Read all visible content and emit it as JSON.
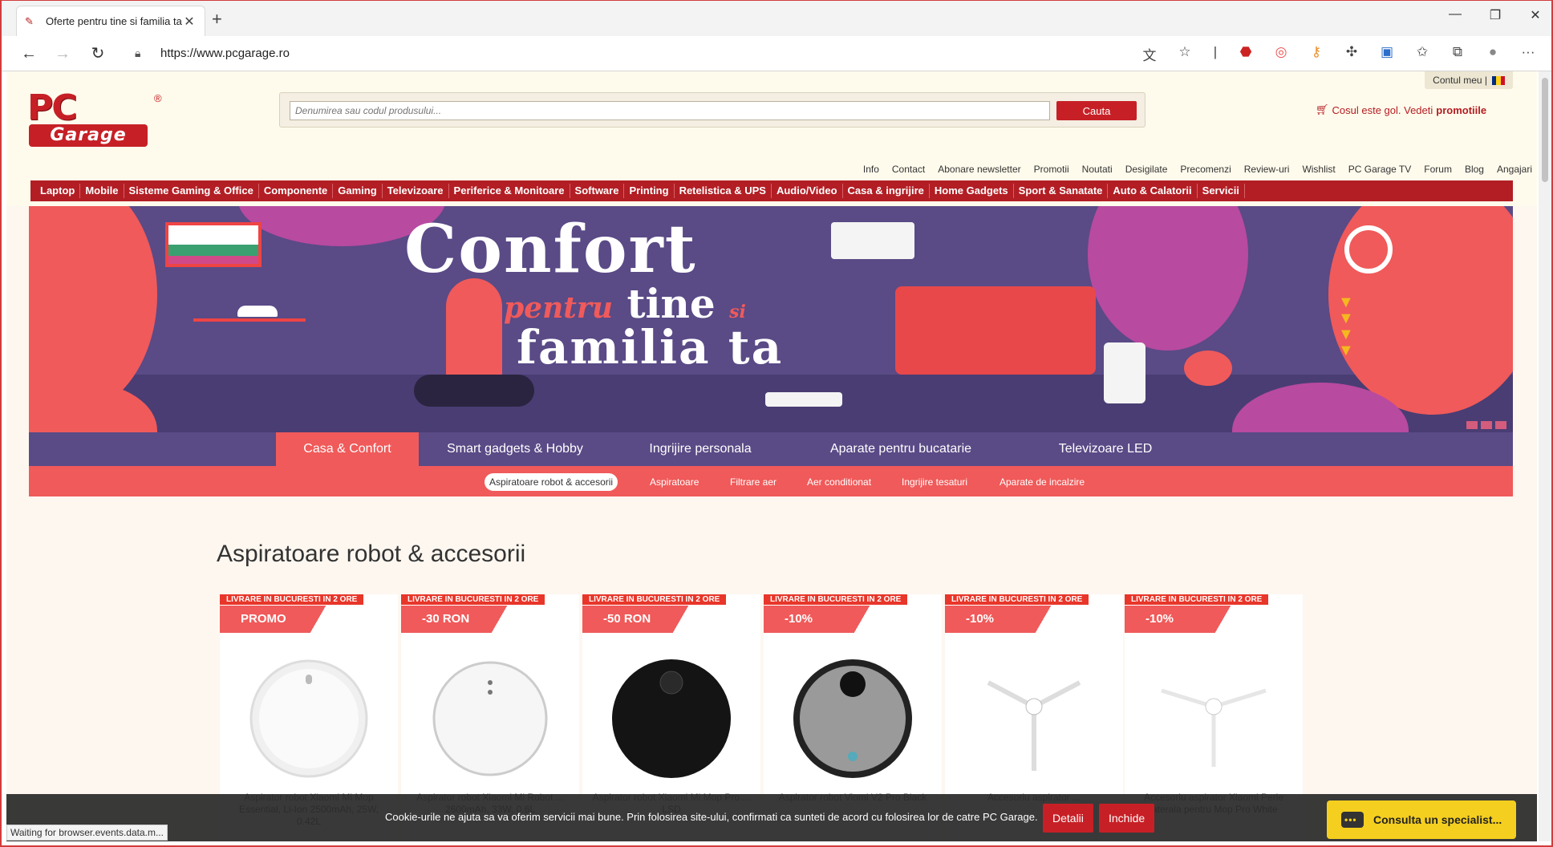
{
  "browser": {
    "tab_title": "Oferte pentru tine si familia ta - ",
    "url": "https://www.pcgarage.ro",
    "status_text": "Waiting for browser.events.data.m..."
  },
  "header": {
    "account_label": "Contul meu |",
    "logo_text": "PC",
    "logo_sub": "Garage",
    "logo_reg": "®",
    "search_placeholder": "Denumirea sau codul produsului...",
    "search_button": "Cauta",
    "cart_text": "Cosul este gol. Vedeti",
    "cart_link": "promotiile",
    "top_links": [
      "Info",
      "Contact",
      "Abonare newsletter",
      "Promotii",
      "Noutati",
      "Desigilate",
      "Precomenzi",
      "Review-uri",
      "Wishlist",
      "PC Garage TV",
      "Forum",
      "Blog",
      "Angajari"
    ],
    "categories": [
      "Laptop",
      "Mobile",
      "Sisteme Gaming & Office",
      "Componente",
      "Gaming",
      "Televizoare",
      "Periferice & Monitoare",
      "Software",
      "Printing",
      "Retelistica & UPS",
      "Audio/Video",
      "Casa & ingrijire",
      "Home Gadgets",
      "Sport & Sanatate",
      "Auto & Calatorii",
      "Servicii"
    ]
  },
  "banner": {
    "line1": "Confort",
    "line2_script": "pentru",
    "line2_main": "tine",
    "line2_small": "si",
    "line3": "familia ta"
  },
  "main_tabs": [
    "Casa & Confort",
    "Smart gadgets & Hobby",
    "Ingrijire personala",
    "Aparate pentru bucatarie",
    "Televizoare LED"
  ],
  "sub_tabs": [
    "Aspiratoare robot & accesorii",
    "Aspiratoare",
    "Filtrare aer",
    "Aer conditionat",
    "Ingrijire tesaturi",
    "Aparate de incalzire"
  ],
  "section_title": "Aspiratoare robot & accesorii",
  "products": [
    {
      "ship": "LIVRARE IN BUCURESTI IN 2 ORE",
      "badge": "PROMO",
      "name": "Aspirator robot Xiaomi Mi Mop Essential, Li-Ion 2500mAh, 25W, 0.42L"
    },
    {
      "ship": "LIVRARE IN BUCURESTI IN 2 ORE",
      "badge": "-30 RON",
      "name": "Aspirator robot Xiaomi Mi Robot ... 2600mAh, 33W, 0.6L"
    },
    {
      "ship": "LIVRARE IN BUCURESTI IN 2 ORE",
      "badge": "-50 RON",
      "name": "Aspirator robot Xiaomi Mi Mop Pro ... LSD"
    },
    {
      "ship": "LIVRARE IN BUCURESTI IN 2 ORE",
      "badge": "-10%",
      "name": "Aspirator robot Viomi V2 Pro Black"
    },
    {
      "ship": "LIVRARE IN BUCURESTI IN 2 ORE",
      "badge": "-10%",
      "name": "Accesoriu aspirator ..."
    },
    {
      "ship": "LIVRARE IN BUCURESTI IN 2 ORE",
      "badge": "-10%",
      "name": "Accesoriu aspirator Xiaomi Perie laterala pentru Mop Pro White"
    }
  ],
  "cookie": {
    "message": "Cookie-urile ne ajuta sa va oferim servicii mai bune. Prin folosirea site-ului, confirmati ca sunteti de acord cu folosirea lor de catre PC Garage.",
    "details": "Detalii",
    "close": "Inchide"
  },
  "consult_label": "Consulta un specialist...",
  "colors": {
    "brand_red": "#c62026",
    "banner_purple": "#5a4a86",
    "coral": "#f05a5a",
    "consult_yellow": "#f5cf1f"
  }
}
